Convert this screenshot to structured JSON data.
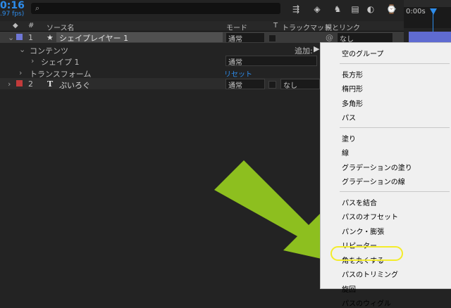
{
  "topbar": {
    "timecode": "0:16",
    "fps": ".97 fps)",
    "search_placeholder": "",
    "ruler_label": "0:00s"
  },
  "columns": {
    "source_name": "ソース名",
    "mode": "モード",
    "t": "T",
    "track_matte": "トラックマット",
    "parent_link": "親とリンク",
    "number": "#"
  },
  "layers": [
    {
      "index": "1",
      "name": "シェイプレイヤー 1",
      "mode": "通常",
      "parent": "なし",
      "color": "#6f77d6"
    },
    {
      "index": "2",
      "name": "ぷいろぐ",
      "mode": "通常",
      "parent": "なし",
      "color": "#c23b3b"
    }
  ],
  "tree": {
    "contents": "コンテンツ",
    "add_label": "追加:",
    "shape": "シェイプ 1",
    "shape_mode": "通常",
    "transform": "トランスフォーム",
    "reset": "リセット"
  },
  "menu": {
    "groups": [
      [
        "空のグループ"
      ],
      [
        "長方形",
        "楕円形",
        "多角形",
        "パス"
      ],
      [
        "塗り",
        "線",
        "グラデーションの塗り",
        "グラデーションの線"
      ],
      [
        "パスを結合",
        "パスのオフセット",
        "パンク・膨張",
        "リピーター",
        "角を丸くする",
        "パスのトリミング",
        "旋回",
        "パスのウィグル"
      ]
    ],
    "highlighted": "パスのトリミング"
  },
  "colors": {
    "accent": "#2d8ceb",
    "highlight": "#f3ec2a",
    "arrow": "#8dbf1f"
  }
}
